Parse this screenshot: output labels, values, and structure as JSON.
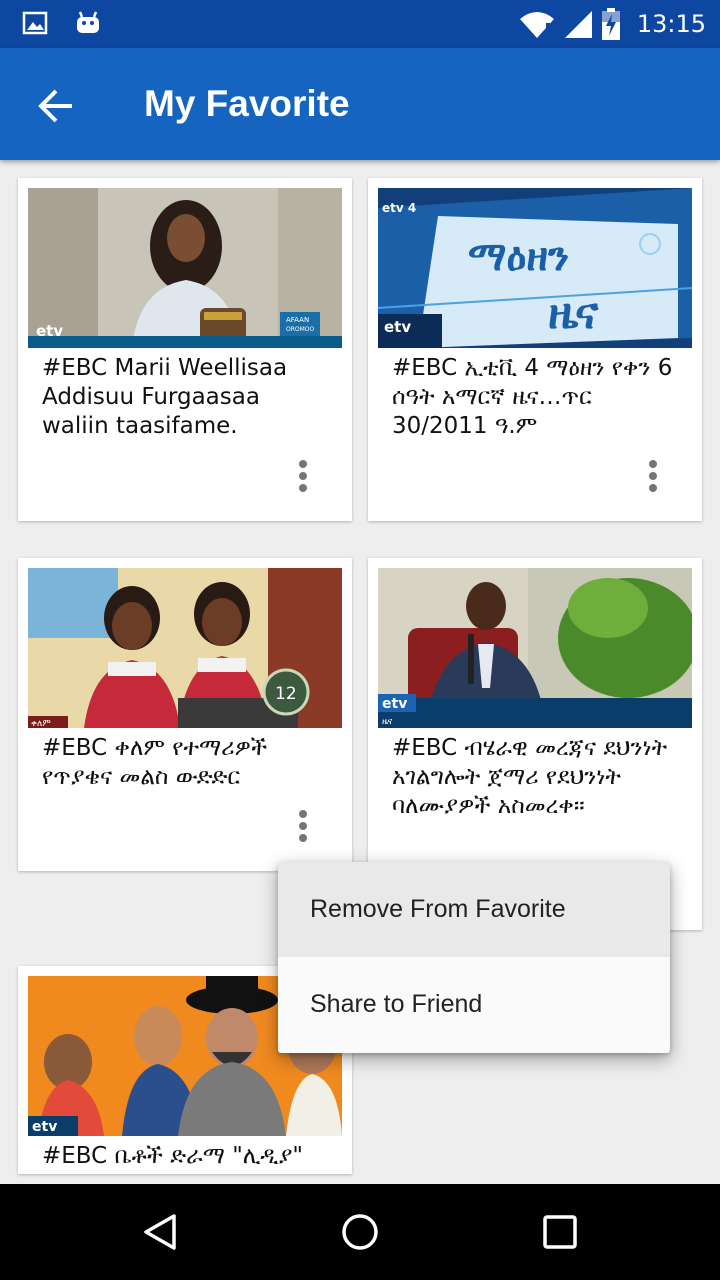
{
  "status_bar": {
    "time": "13:15",
    "icons": [
      "image-icon",
      "android-icon",
      "wifi-icon",
      "signal-icon",
      "battery-charging-icon"
    ]
  },
  "app_bar": {
    "back_icon": "arrow-back-icon",
    "title": "My Favorite",
    "color": "#1565c0"
  },
  "videos": [
    {
      "title": "#EBC Marii Weellisaa Addisuu Furgaasaa waliin taasifame.",
      "thumb_text": [
        "etv",
        "AFAAN",
        "OROMOO"
      ]
    },
    {
      "title": "#EBC ኢቲቪ 4 ማዕዘን የቀን 6 ሰዓት አማርኛ ዜና…ጥር 30/2011 ዓ.ም",
      "thumb_text": [
        "etv 4",
        "ማዕዘን",
        "ዜና",
        "etv"
      ]
    },
    {
      "title": "#EBC ቀለም የተማሪዎች የጥያቄና መልስ ውድድር",
      "thumb_text": [
        "12",
        "ቀለም"
      ]
    },
    {
      "title": "#EBC  ብሄራዊ መረጃና ደህንነት አገልግሎት ጀማሪ የደህንነት ባለሙያዎች አስመረቀ።",
      "thumb_text": [
        "etv",
        "ዜና"
      ]
    },
    {
      "title": "#EBC ቤቶች ድራማ \"ሊዲያ\"",
      "thumb_text": [
        "etv"
      ]
    }
  ],
  "popup_menu": {
    "items": [
      "Remove From Favorite",
      "Share to Friend"
    ],
    "highlighted_index": 0
  },
  "nav_bar": {
    "icons": [
      "back-triangle-icon",
      "home-circle-icon",
      "recents-square-icon"
    ]
  }
}
